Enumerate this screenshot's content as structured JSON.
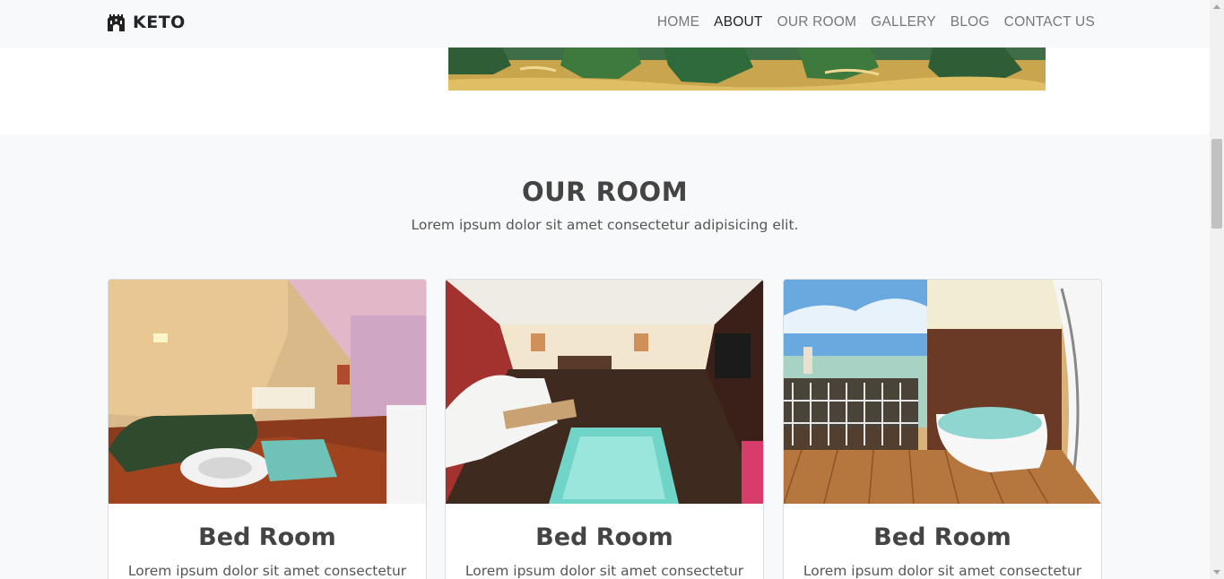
{
  "brand": {
    "name": "KETO",
    "icon": "castle-logo-icon"
  },
  "nav": {
    "items": [
      {
        "label": "HOME",
        "active": false
      },
      {
        "label": "ABOUT",
        "active": true
      },
      {
        "label": "OUR ROOM",
        "active": false
      },
      {
        "label": "GALLERY",
        "active": false
      },
      {
        "label": "BLOG",
        "active": false
      },
      {
        "label": "CONTACT US",
        "active": false
      }
    ]
  },
  "rooms": {
    "title": "OUR ROOM",
    "subtitle": "Lorem ipsum dolor sit amet consectetur adipisicing elit.",
    "cards": [
      {
        "title": "Bed Room",
        "text": "Lorem ipsum dolor sit amet consectetur",
        "image": "living-room-with-glass-floor"
      },
      {
        "title": "Bed Room",
        "text": "Lorem ipsum dolor sit amet consectetur",
        "image": "suite-lounge-with-glass-floor"
      },
      {
        "title": "Bed Room",
        "text": "Lorem ipsum dolor sit amet consectetur",
        "image": "balcony-jacuzzi-sea-view"
      }
    ]
  },
  "colors": {
    "section_bg": "#f8f9fa",
    "text": "#444444",
    "nav_inactive": "#777777",
    "nav_active": "#222222"
  }
}
